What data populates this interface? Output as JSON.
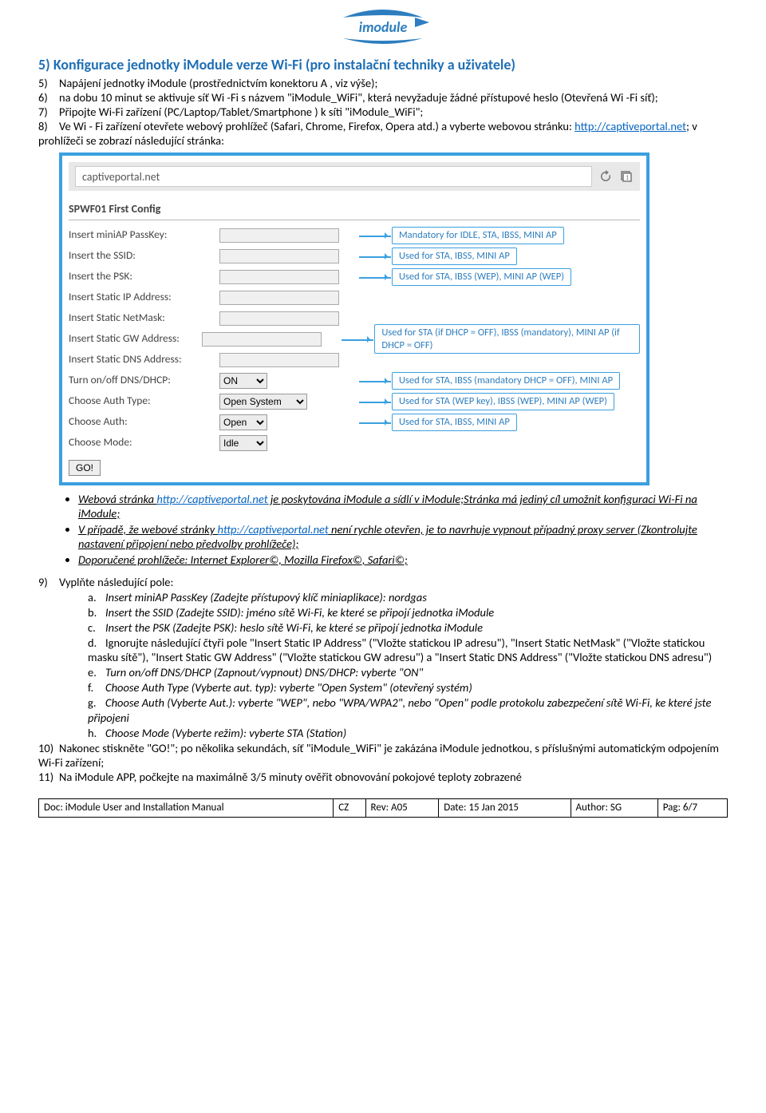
{
  "logo_text": "imodule",
  "heading_marker": "5)",
  "heading": "Konfigurace jednotky iModule verze Wi-Fi (pro instalační techniky a uživatele)",
  "steps": {
    "s5_marker": "5)",
    "s5": "Napájení jednotky iModule (prostřednictvím konektoru A , viz výše);",
    "s6_marker": "6)",
    "s6": "na dobu 10 minut se aktivuje síť Wi -Fi s názvem \"iModule_WiFi\", která nevyžaduje žádné přístupové heslo (Otevřená Wi -Fi síť);",
    "s7_marker": "7)",
    "s7": "Připojte Wi-Fi zařízení (PC/Laptop/Tablet/Smartphone ) k síti \"iModule_WiFi\";",
    "s8_marker": "8)",
    "s8_a": "Ve Wi - Fi zařízení otevřete webový prohlížeč (Safari, Chrome, Firefox, Opera atd.) a vyberte webovou stránku: ",
    "s8_link": "http://captiveportal.net",
    "s8_b": "; v prohlížeči se zobrazí následující stránka:"
  },
  "browser": {
    "url": "captiveportal.net",
    "fieldset": "SPWF01 First Config",
    "rows": [
      {
        "label": "Insert miniAP PassKey:",
        "type": "text",
        "callout": "Mandatory for IDLE, STA, IBSS, MINI AP"
      },
      {
        "label": "Insert the SSID:",
        "type": "text",
        "callout": "Used for STA, IBSS, MINI AP"
      },
      {
        "label": "Insert the PSK:",
        "type": "text",
        "callout": "Used for STA, IBSS (WEP), MINI AP (WEP)"
      },
      {
        "label": "Insert Static IP Address:",
        "type": "text",
        "callout": ""
      },
      {
        "label": "Insert Static NetMask:",
        "type": "text",
        "callout": ""
      },
      {
        "label": "Insert Static GW Address:",
        "type": "text",
        "callout": "Used for STA (if DHCP = OFF), IBSS (mandatory), MINI AP (if DHCP = OFF)"
      },
      {
        "label": "Insert Static DNS Address:",
        "type": "text",
        "callout": ""
      },
      {
        "label": "Turn on/off DNS/DHCP:",
        "type": "select",
        "value": "ON",
        "callout": "Used for STA, IBSS (mandatory DHCP = OFF), MINI AP"
      },
      {
        "label": "Choose Auth Type:",
        "type": "select",
        "value": "Open System",
        "callout": "Used for STA (WEP key), IBSS (WEP), MINI AP (WEP)"
      },
      {
        "label": "Choose Auth:",
        "type": "select",
        "value": "Open",
        "callout": "Used for STA, IBSS, MINI AP"
      },
      {
        "label": "Choose Mode:",
        "type": "select",
        "value": "Idle",
        "callout": ""
      }
    ],
    "go": "GO!"
  },
  "notes": {
    "b1a": "Webová stránka ",
    "b1link": "http://captiveportal.net",
    "b1b": " je poskytována iModule a sídlí v iModule;Stránka má jediný cíl umožnit konfiguraci Wi-Fi na iModule;",
    "b2a": "V případě, že webové stránky ",
    "b2link": "http://captiveportal.net",
    "b2b": " není rychle otevřen, je to navrhuje vypnout případný proxy server (Zkontrolujte nastavení připojení nebo předvolby prohlížeče);",
    "b3": "Doporučené prohlížeče: Internet Explorer©, Mozilla Firefox©, Safari©;"
  },
  "s9_marker": "9)",
  "s9": "Vyplňte následující pole:",
  "sub": {
    "a_m": "a.",
    "a": "Insert miniAP PassKey (Zadejte přístupový klíč miniaplikace): nordgas",
    "b_m": "b.",
    "b": "Insert the SSID (Zadejte SSID): jméno sítě Wi-Fi, ke které se připojí jednotka iModule",
    "c_m": "c.",
    "c": "Insert the PSK (Zadejte PSK): heslo sítě Wi-Fi, ke které se připojí jednotka iModule",
    "d_m": "d.",
    "d": "Ignorujte následující čtyři pole \"Insert Static IP Address\" (\"Vložte statickou IP adresu\"), \"Insert Static NetMask\" (\"Vložte statickou masku sítě\"), \"Insert Static GW Address\" (\"Vložte statickou GW adresu\") a \"Insert Static DNS Address\" (\"Vložte statickou DNS adresu\")",
    "e_m": "e.",
    "e": "Turn on/off DNS/DHCP (Zapnout/vypnout) DNS/DHCP: vyberte \"ON\"",
    "f_m": "f.",
    "f": "Choose Auth Type (Vyberte aut. typ): vyberte \"Open System\" (otevřený systém)",
    "g_m": "g.",
    "g": "Choose Auth (Vyberte Aut.): vyberte \"WEP\", nebo \"WPA/WPA2\", nebo \"Open\" podle protokolu zabezpečení sítě Wi-Fi, ke které jste připojeni",
    "h_m": "h.",
    "h": "Choose Mode (Vyberte režim): vyberte STA (Station)"
  },
  "s10_marker": "10)",
  "s10": "Nakonec stiskněte \"GO!\"; po několika sekundách, síť \"iModule_WiFi\" je zakázána iModule jednotkou, s příslušnými automatickým odpojením Wi-Fi zařízení;",
  "s11_marker": "11)",
  "s11": "Na iModule APP, počkejte na maximálně 3/5 minuty ověřit obnovování pokojové teploty zobrazené",
  "footer": {
    "doc": "Doc: iModule User and Installation Manual",
    "lang": "CZ",
    "rev": "Rev: A05",
    "date": "Date: 15 Jan 2015",
    "author": "Author: SG",
    "page": "Pag: 6/7"
  }
}
